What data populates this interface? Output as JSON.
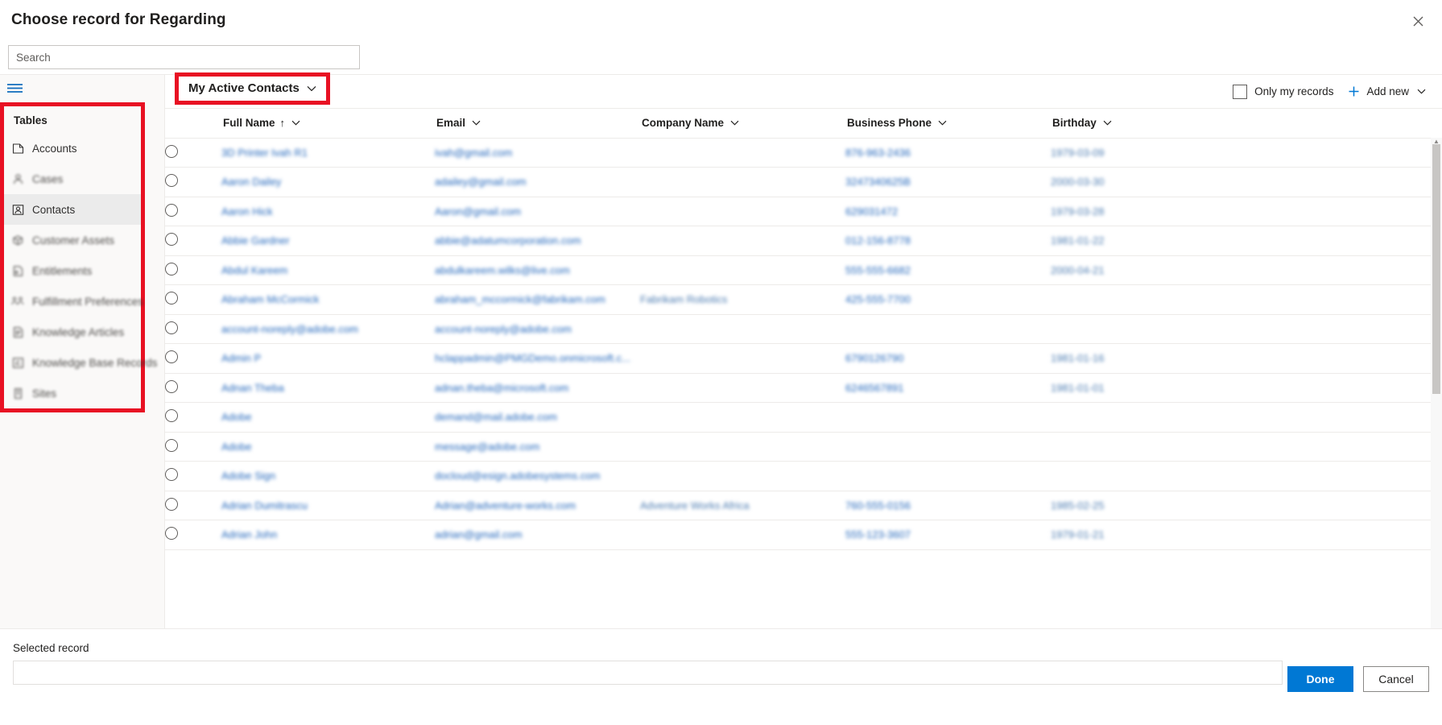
{
  "dialog": {
    "title": "Choose record for Regarding",
    "close_icon": "close-icon"
  },
  "search": {
    "value": "",
    "placeholder": "Search"
  },
  "sidebar": {
    "menu_icon": "hamburger-icon",
    "caption": "Tables",
    "items": [
      {
        "label": "Accounts",
        "icon": "account-icon",
        "selected": false,
        "blurred": false
      },
      {
        "label": "Cases",
        "icon": "case-icon",
        "selected": false,
        "blurred": true
      },
      {
        "label": "Contacts",
        "icon": "contact-icon",
        "selected": true,
        "blurred": false
      },
      {
        "label": "Customer Assets",
        "icon": "asset-box-icon",
        "selected": false,
        "blurred": true
      },
      {
        "label": "Entitlements",
        "icon": "entitlement-doc-icon",
        "selected": false,
        "blurred": true
      },
      {
        "label": "Fulfillment Preferences",
        "icon": "people-icon",
        "selected": false,
        "blurred": true
      },
      {
        "label": "Knowledge Articles",
        "icon": "article-icon",
        "selected": false,
        "blurred": true
      },
      {
        "label": "Knowledge Base Records",
        "icon": "kb-record-icon",
        "selected": false,
        "blurred": true
      },
      {
        "label": "Sites",
        "icon": "site-icon",
        "selected": false,
        "blurred": true
      }
    ]
  },
  "command_bar": {
    "view_picker_label": "My Active Contacts",
    "view_picker_chevron": "chevron-down-icon",
    "only_my_records_label": "Only my records",
    "only_my_records_checked": false,
    "add_new_label": "Add new",
    "add_new_icon": "plus-icon",
    "add_new_chevron": "chevron-down-icon"
  },
  "grid": {
    "columns": [
      {
        "key": "select",
        "label": ""
      },
      {
        "key": "fullname",
        "label": "Full Name",
        "sorted": true,
        "sort_icon": "sort-ascending-icon",
        "chevron": "chevron-down-icon"
      },
      {
        "key": "email",
        "label": "Email",
        "sorted": false,
        "chevron": "chevron-down-icon"
      },
      {
        "key": "company",
        "label": "Company Name",
        "sorted": false,
        "chevron": "chevron-down-icon"
      },
      {
        "key": "phone",
        "label": "Business Phone",
        "sorted": false,
        "chevron": "chevron-down-icon"
      },
      {
        "key": "birthday",
        "label": "Birthday",
        "sorted": false,
        "chevron": "chevron-down-icon"
      }
    ],
    "rows": [
      {
        "fullname": "3D Printer Ivah R1",
        "email": "ivah@gmail.com",
        "company": "",
        "phone": "876-963-2436",
        "birthday": "1979-03-09"
      },
      {
        "fullname": "Aaron Dailey",
        "email": "adailey@gmail.com",
        "company": "",
        "phone": "3247340625B",
        "birthday": "2000-03-30"
      },
      {
        "fullname": "Aaron Hick",
        "email": "Aaron@gmail.com",
        "company": "",
        "phone": "629031472",
        "birthday": "1979-03-28"
      },
      {
        "fullname": "Abbie Gardner",
        "email": "abbie@adatumcorporation.com",
        "company": "",
        "phone": "012-156-8778",
        "birthday": "1981-01-22"
      },
      {
        "fullname": "Abdul Kareem",
        "email": "abdulkareem.wilks@live.com",
        "company": "",
        "phone": "555-555-6682",
        "birthday": "2000-04-21"
      },
      {
        "fullname": "Abraham McCormick",
        "email": "abraham_mccormick@fabrikam.com",
        "company": "Fabrikam Robotics",
        "phone": "425-555-7700",
        "birthday": ""
      },
      {
        "fullname": "account-noreply@adobe.com",
        "email": "account-noreply@adobe.com",
        "company": "",
        "phone": "",
        "birthday": ""
      },
      {
        "fullname": "Admin P",
        "email": "hclappadmin@PMGDemo.onmicrosoft.c...",
        "company": "",
        "phone": "6790126790",
        "birthday": "1981-01-16"
      },
      {
        "fullname": "Adnan Theba",
        "email": "adnan.theba@microsoft.com",
        "company": "",
        "phone": "6246567891",
        "birthday": "1981-01-01"
      },
      {
        "fullname": "Adobe",
        "email": "demand@mail.adobe.com",
        "company": "",
        "phone": "",
        "birthday": ""
      },
      {
        "fullname": "Adobe",
        "email": "message@adobe.com",
        "company": "",
        "phone": "",
        "birthday": ""
      },
      {
        "fullname": "Adobe Sign",
        "email": "docloud@esign.adobesystems.com",
        "company": "",
        "phone": "",
        "birthday": ""
      },
      {
        "fullname": "Adrian Dumitrascu",
        "email": "Adrian@adventure-works.com",
        "company": "Adventure Works Africa",
        "phone": "760-555-0156",
        "birthday": "1985-02-25"
      },
      {
        "fullname": "Adrian John",
        "email": "adrian@gmail.com",
        "company": "",
        "phone": "555-123-3607",
        "birthday": "1979-01-21"
      }
    ]
  },
  "footer": {
    "selected_record_label": "Selected record",
    "selected_record_value": "",
    "done_label": "Done",
    "cancel_label": "Cancel",
    "primary_color": "#0078d4"
  },
  "highlight_color": "#e81123"
}
